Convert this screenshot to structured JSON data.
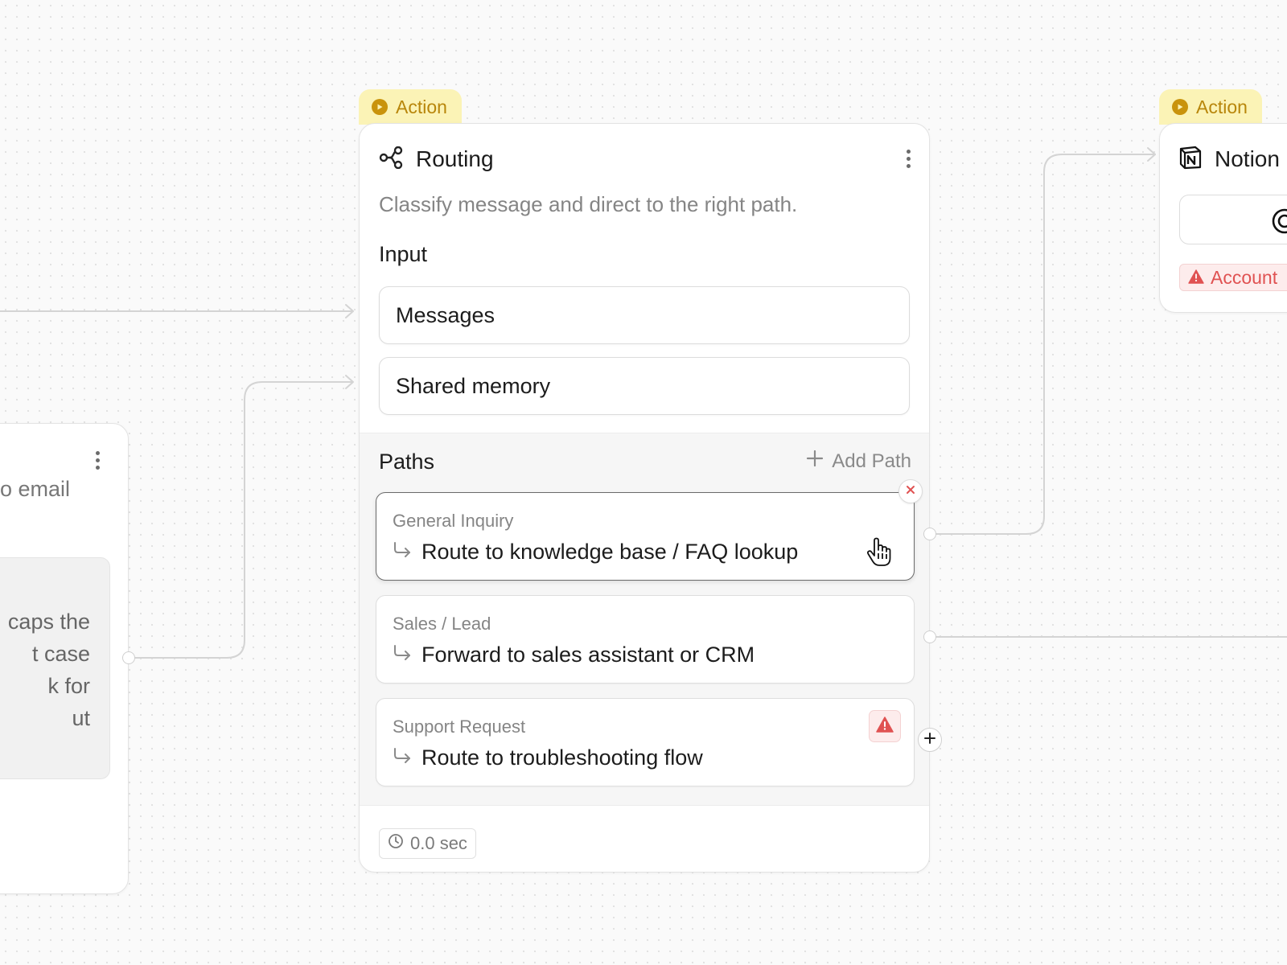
{
  "left_node": {
    "description_fragment": "o email",
    "prompt_lines": [
      "caps the",
      "t case",
      "k for",
      "ut"
    ]
  },
  "routing_node": {
    "tag": "Action",
    "title": "Routing",
    "description": "Classify message and direct to the right path.",
    "input_label": "Input",
    "inputs": [
      "Messages",
      "Shared memory"
    ],
    "paths_label": "Paths",
    "add_path_label": "Add Path",
    "paths": [
      {
        "name": "General Inquiry",
        "destination": "Route to knowledge base / FAQ lookup"
      },
      {
        "name": "Sales / Lead",
        "destination": "Forward to sales assistant or CRM"
      },
      {
        "name": "Support Request",
        "destination": "Route to troubleshooting flow"
      }
    ],
    "duration": "0.0 sec"
  },
  "notion_node": {
    "tag": "Action",
    "title": "Notion",
    "warning": "Account"
  },
  "icons": {
    "tag": "play-circle-icon",
    "routing": "branch-icon",
    "menu": "kebab-icon",
    "add": "plus-icon",
    "close": "close-icon",
    "path_arrow": "return-arrow-icon",
    "warning": "warning-icon",
    "clock": "clock-icon",
    "notion": "notion-logo-icon",
    "cursor": "hand-pointer-icon"
  },
  "colors": {
    "tag_background": "#fbf3b6",
    "tag_text": "#b8860b",
    "warning": "#e05252",
    "edge": "#d4d4d4"
  }
}
